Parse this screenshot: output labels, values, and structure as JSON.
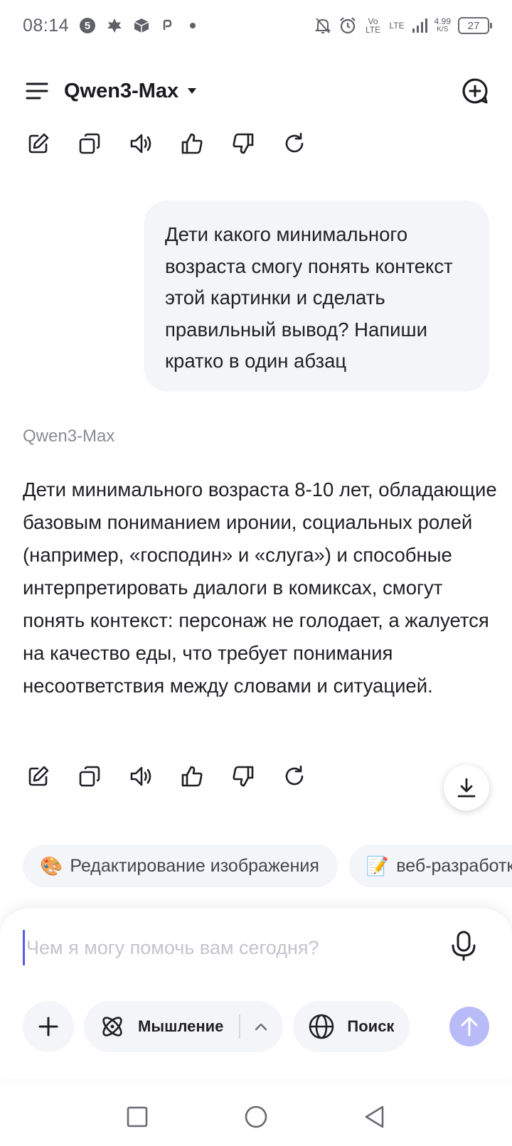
{
  "status_bar": {
    "time": "08:14",
    "notification_icons": [
      "five-badge-icon",
      "leaf-icon",
      "box-icon",
      "p-icon",
      "dot-icon"
    ],
    "net_speed_value": "4.99",
    "net_speed_unit": "K/S",
    "volte_label": "Vo LTE",
    "lte_label": "LTE",
    "battery": "27"
  },
  "header": {
    "model_title": "Qwen3-Max"
  },
  "conversation": {
    "user_message": "Дети какого минимального возраста смогу понять контекст этой картинки и сделать правильный вывод? Напиши кратко в один абзац",
    "assistant_name": "Qwen3-Max",
    "assistant_message": "Дети минимального возраста 8-10 лет, обладающие базовым пониманием иронии, социальных ролей (например, «господин» и «слуга») и способные интерпретировать диалоги в комиксах, смогут понять контекст: персонаж не голодает, а жалуется на качество еды, что требует понимания несоответствия между словами и ситуацией."
  },
  "action_icons": [
    "edit-icon",
    "copy-icon",
    "speaker-icon",
    "thumbs-up-icon",
    "thumbs-down-icon",
    "regenerate-icon"
  ],
  "suggestions": [
    {
      "emoji": "🎨",
      "label": "Редактирование изображения"
    },
    {
      "emoji": "📝",
      "label": "веб-разработка"
    }
  ],
  "input": {
    "placeholder": "Чем я могу помочь вам сегодня?",
    "value": ""
  },
  "toolbar": {
    "thinking_label": "Мышление",
    "search_label": "Поиск"
  },
  "colors": {
    "accent": "#5b5ce0",
    "send_button": "#b9bbf8",
    "bubble_bg": "#f4f5f9",
    "muted_text": "#8a8c95"
  }
}
